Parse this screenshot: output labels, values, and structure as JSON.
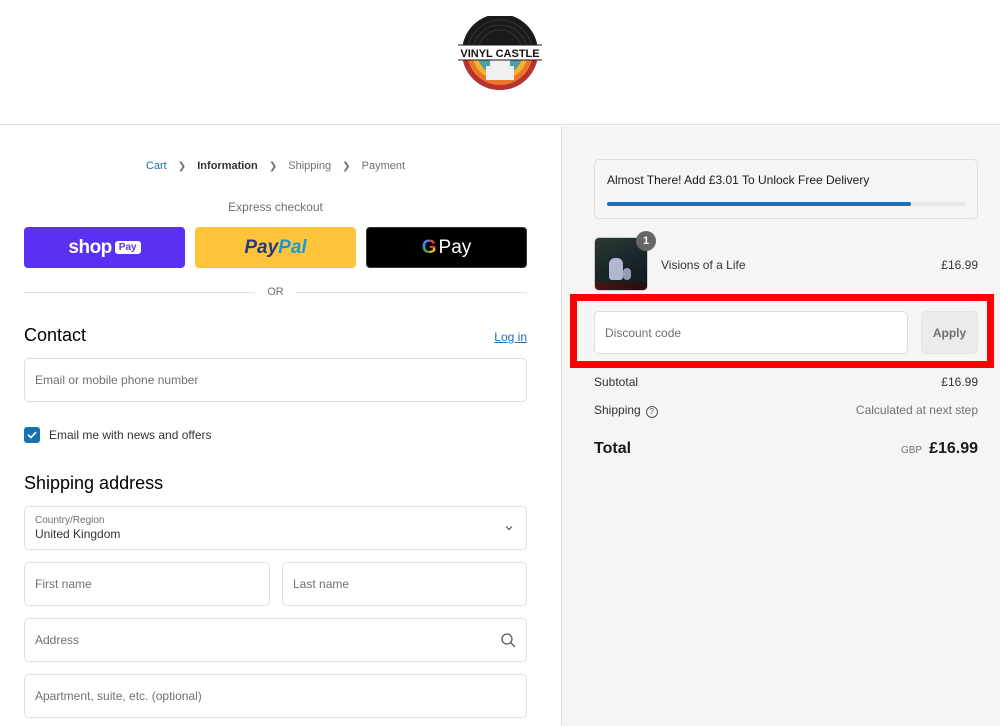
{
  "header": {
    "logo_text": "VINYL CASTLE"
  },
  "breadcrumb": {
    "items": [
      {
        "label": "Cart",
        "state": "link"
      },
      {
        "label": "Information",
        "state": "current"
      },
      {
        "label": "Shipping",
        "state": "upcoming"
      },
      {
        "label": "Payment",
        "state": "upcoming"
      }
    ],
    "separator_icon": "chevron-right-icon"
  },
  "express_checkout": {
    "label": "Express checkout",
    "shop_pay": {
      "word": "shop",
      "badge": "Pay",
      "color": "#5a31f4"
    },
    "paypal": {
      "part1": "Pay",
      "part2": "Pal",
      "color": "#ffc439"
    },
    "google_pay": {
      "g": "G",
      "word": "Pay",
      "color": "#000000"
    },
    "divider_label": "OR"
  },
  "contact": {
    "title": "Contact",
    "login_label": "Log in",
    "email_placeholder": "Email or mobile phone number",
    "newsletter_label": "Email me with news and offers",
    "newsletter_checked": true
  },
  "shipping_address": {
    "title": "Shipping address",
    "country_label": "Country/Region",
    "country_value": "United Kingdom",
    "first_name_placeholder": "First name",
    "last_name_placeholder": "Last name",
    "address_placeholder": "Address",
    "apartment_placeholder": "Apartment, suite, etc. (optional)"
  },
  "summary": {
    "promo": {
      "text": "Almost There! Add £3.01 To Unlock Free Delivery",
      "progress_percent": 85,
      "progress_color": "#1f6fb2"
    },
    "items": [
      {
        "name": "Visions of a Life",
        "quantity": "1",
        "price": "£16.99"
      }
    ],
    "discount": {
      "placeholder": "Discount code",
      "apply_label": "Apply",
      "highlight_color": "#ff0000"
    },
    "subtotal_label": "Subtotal",
    "subtotal_value": "£16.99",
    "shipping_label": "Shipping",
    "shipping_value": "Calculated at next step",
    "total_label": "Total",
    "currency": "GBP",
    "total_value": "£16.99"
  }
}
